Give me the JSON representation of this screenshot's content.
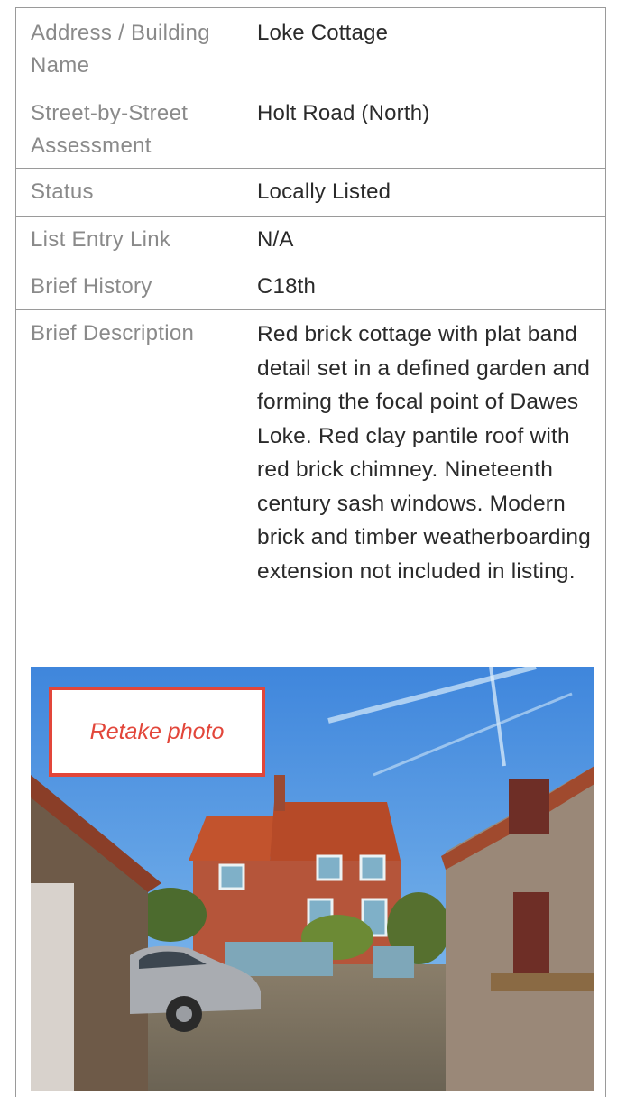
{
  "rows": [
    {
      "label": "Address / Building Name",
      "value": "Loke Cottage"
    },
    {
      "label": "Street-by-Street Assessment",
      "value": "Holt Road (North)"
    },
    {
      "label": "Status",
      "value": "Locally Listed"
    },
    {
      "label": "List Entry Link",
      "value": "N/A"
    },
    {
      "label": "Brief History",
      "value": "C18th"
    },
    {
      "label": "Brief Description",
      "value": "Red brick cottage with plat band detail set in a defined garden and forming the focal point of Dawes Loke. Red clay pantile roof with red brick chimney. Nineteenth century sash windows. Modern brick and timber weatherboarding extension not included in listing."
    }
  ],
  "photo": {
    "retake_label": "Retake photo"
  },
  "colors": {
    "border": "#9a9a9a",
    "label": "#8a8a8a",
    "value": "#2a2a2a",
    "accent": "#e2463a"
  }
}
